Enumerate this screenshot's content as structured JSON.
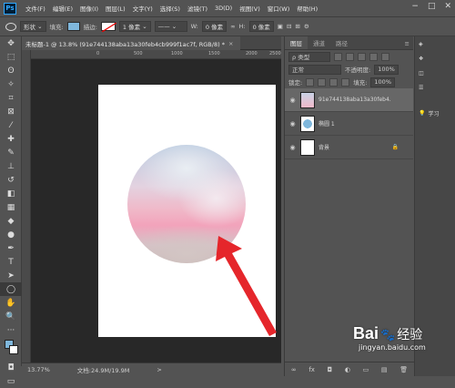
{
  "menubar": {
    "logo": "Ps",
    "items": [
      "文件(F)",
      "编辑(E)",
      "图像(I)",
      "图层(L)",
      "文字(Y)",
      "选择(S)",
      "滤镜(T)",
      "3D(D)",
      "视图(V)",
      "窗口(W)",
      "帮助(H)"
    ],
    "win_min": "−",
    "win_max": "□",
    "win_close": "✕"
  },
  "options": {
    "shape_mode": "形状",
    "fill_label": "填充:",
    "stroke_label": "描边:",
    "stroke_width": "1 像素",
    "w_label": "W:",
    "w_value": "0 像素",
    "link": "∞",
    "h_label": "H:",
    "h_value": "0 像素",
    "colors": {
      "fill": "#7fb7dc"
    }
  },
  "document": {
    "tab_title": "未标题-1 @ 13.8% (91e744138aba13a30feb4cb999f1ac7f, RGB/8) *",
    "tab_close": "×",
    "ruler_marks": [
      "0",
      "500",
      "1000",
      "1500",
      "2000",
      "2500"
    ],
    "zoom": "13.77%",
    "doc_info": "文档:24.9M/19.9M",
    "status_arrow": ">"
  },
  "panel": {
    "tabs": [
      "图层",
      "通道",
      "路径"
    ],
    "filter_kind": "ρ 类型",
    "blend_mode": "正常",
    "opacity_label": "不透明度:",
    "opacity_value": "100%",
    "lock_label": "锁定:",
    "fill_label": "填充:",
    "fill_value": "100%",
    "layers": [
      {
        "name": "91e744138aba13a30feb4...",
        "selected": true
      },
      {
        "name": "椭圆 1",
        "selected": false
      },
      {
        "name": "背景",
        "selected": false
      }
    ],
    "lock_icon": "🔒",
    "bottom_icons": [
      "∞",
      "fx",
      "◘",
      "◐",
      "▭",
      "▤",
      "🗑"
    ]
  },
  "dock": {
    "items": [
      {
        "label": "",
        "icon": "layers-icon"
      },
      {
        "label": "",
        "icon": "channels-icon"
      },
      {
        "label": "",
        "icon": "paths-icon"
      },
      {
        "label": "",
        "icon": "properties-icon"
      },
      {
        "label": "学习",
        "icon": "learn-icon"
      }
    ]
  },
  "watermark": {
    "brand": "Bai",
    "brand2": "经验",
    "url": "jingyan.baidu.com"
  }
}
